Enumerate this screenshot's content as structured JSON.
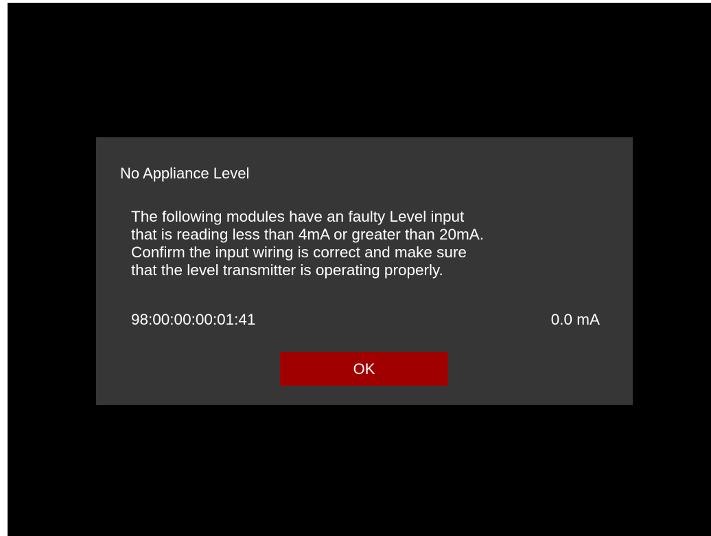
{
  "dialog": {
    "title": "No Appliance Level",
    "message_lines": [
      "The following modules have an faulty Level input",
      "that is reading less than 4mA or greater than 20mA.",
      "Confirm the input wiring is correct and make sure",
      "that the level transmitter is operating properly."
    ],
    "modules": [
      {
        "id": "98:00:00:00:01:41",
        "reading": "0.0 mA"
      }
    ],
    "ok_label": "OK"
  },
  "colors": {
    "screen_background": "#000000",
    "dialog_background": "#363636",
    "button_background": "#a10000",
    "text": "#ffffff"
  }
}
